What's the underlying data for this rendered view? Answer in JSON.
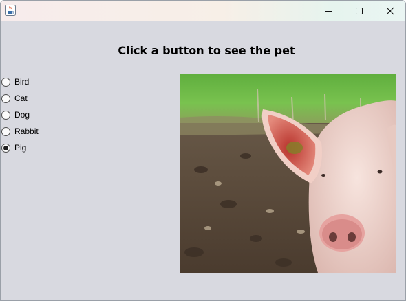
{
  "window": {
    "icon": "java-cup-icon",
    "controls": [
      "minimize-icon",
      "maximize-icon",
      "close-icon"
    ]
  },
  "heading": "Click a button to see the pet",
  "pets": [
    {
      "label": "Bird",
      "selected": false
    },
    {
      "label": "Cat",
      "selected": false
    },
    {
      "label": "Dog",
      "selected": false
    },
    {
      "label": "Rabbit",
      "selected": false
    },
    {
      "label": "Pig",
      "selected": true
    }
  ],
  "image": {
    "subject": "pig",
    "colors": {
      "sky_grass": "#6bb847",
      "mud": "#5a4a3a",
      "pig_skin": "#f2d6cf",
      "ear_inner": "#c7483e",
      "snout": "#e7a7a0"
    }
  }
}
